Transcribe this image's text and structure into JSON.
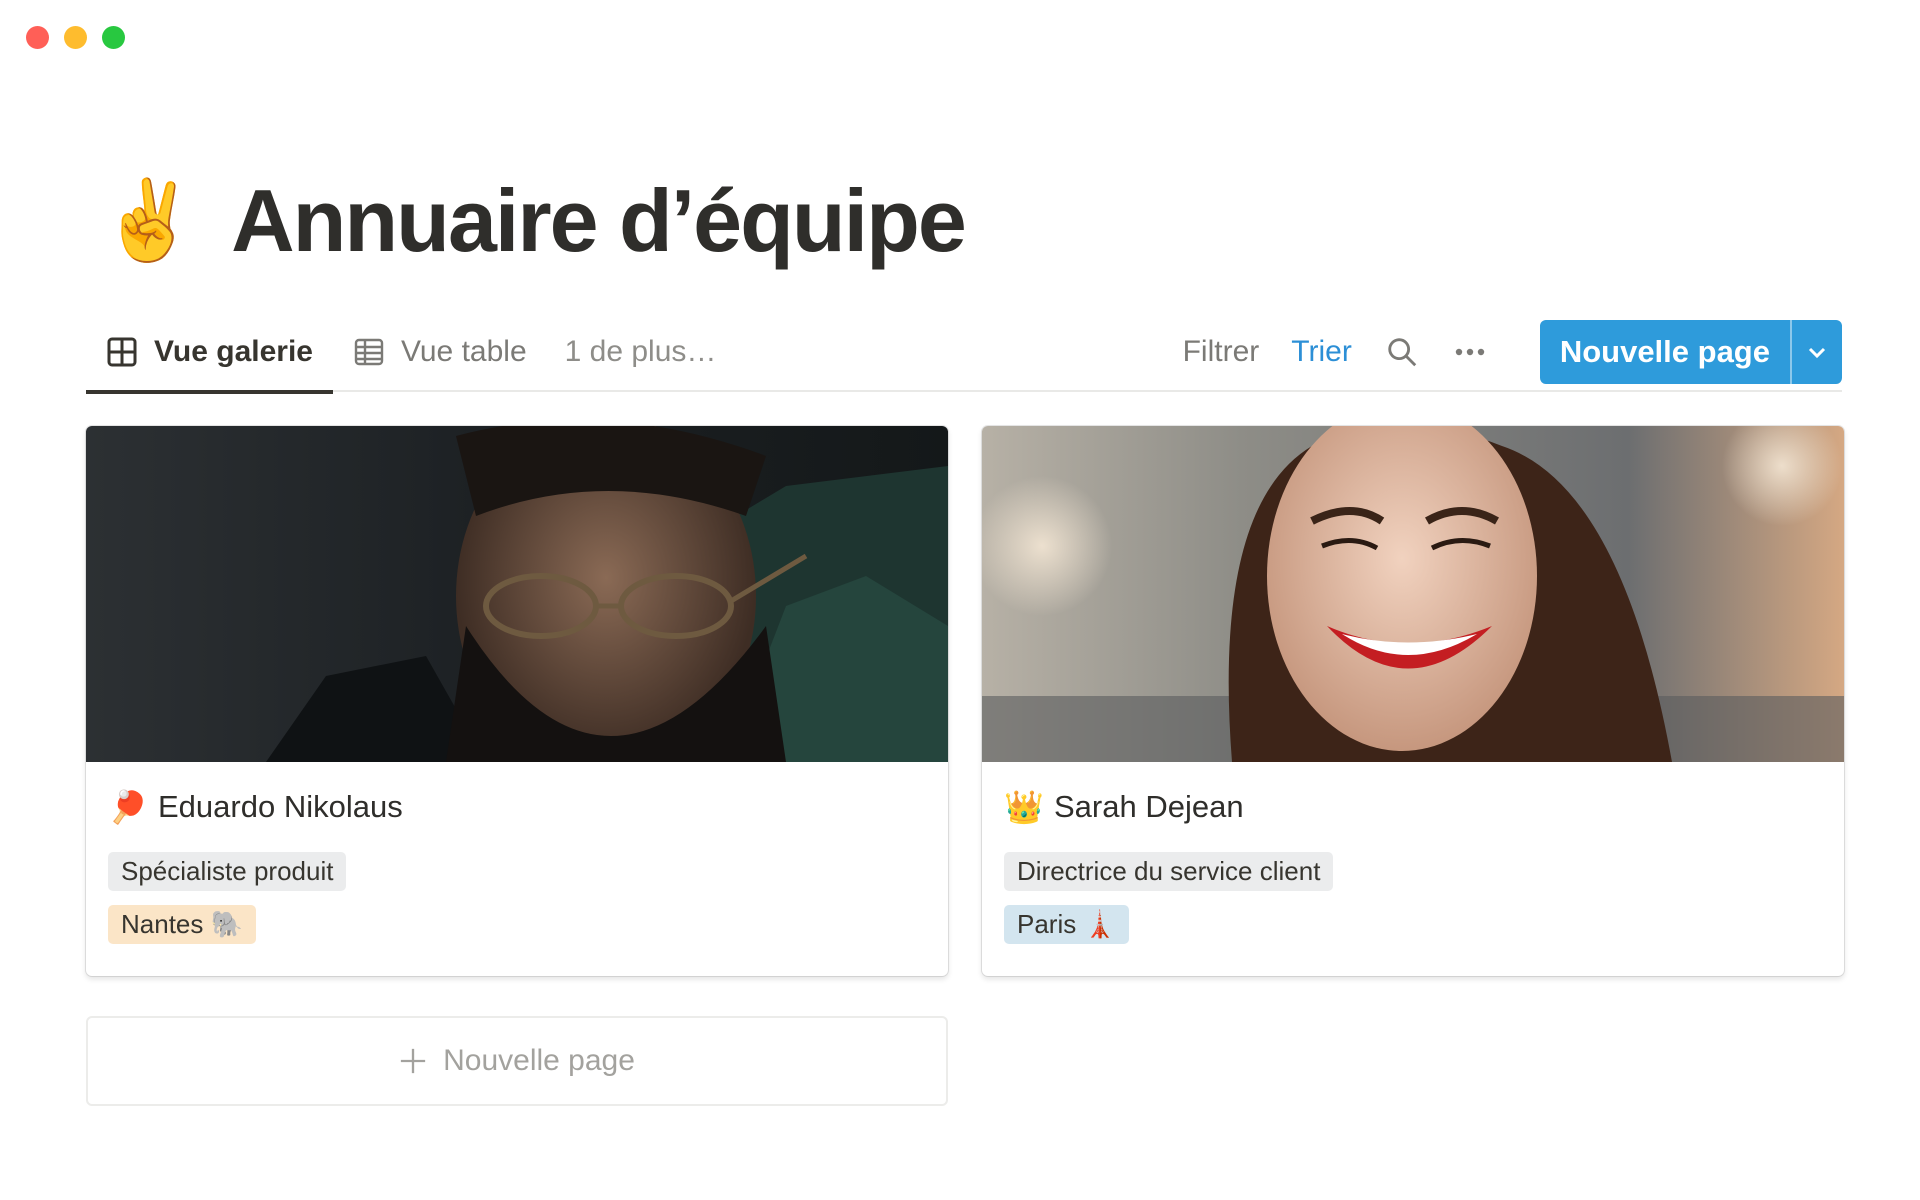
{
  "page": {
    "title": "Annuaire d’équipe",
    "title_emoji": "✌️"
  },
  "viewbar": {
    "tabs": [
      {
        "label": "Vue galerie",
        "icon": "gallery-grid-icon",
        "active": true
      },
      {
        "label": "Vue table",
        "icon": "table-icon",
        "active": false
      }
    ],
    "more_views": "1 de plus…",
    "filter_label": "Filtrer",
    "sort_label": "Trier",
    "search_icon": "search-icon",
    "more_icon": "ellipsis-icon",
    "new_page_label": "Nouvelle page",
    "accent_color": "#2e9bdb",
    "sort_color": "#2c8fd6"
  },
  "cards": [
    {
      "emoji": "🏓",
      "name": "Eduardo Nikolaus",
      "role": "Spécialiste produit",
      "city": "Nantes",
      "city_emoji": "🐘",
      "city_color": "#fbe5c7"
    },
    {
      "emoji": "👑",
      "name": "Sarah Dejean",
      "role": "Directrice du service client",
      "city": "Paris",
      "city_emoji": "🗼",
      "city_color": "#d3e5ef"
    }
  ],
  "gallery": {
    "add_page_label": "Nouvelle page"
  }
}
